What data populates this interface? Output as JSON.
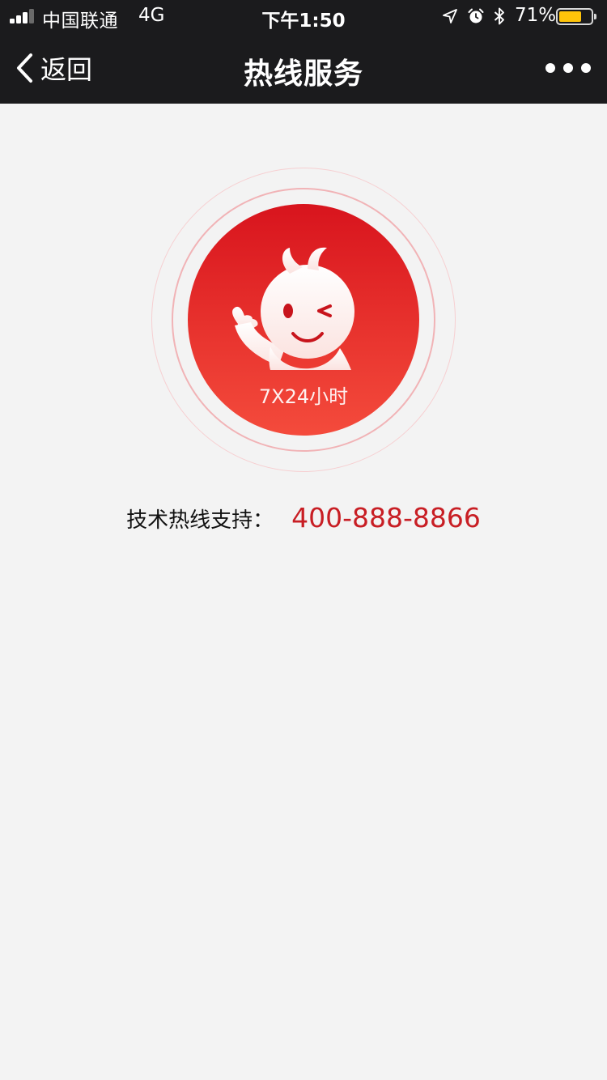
{
  "status_bar": {
    "carrier": "中国联通",
    "network": "4G",
    "time": "下午1:50",
    "battery_percent_label": "71%",
    "battery_level": 0.71,
    "battery_color": "#ffc40a",
    "signal_bars_active": 3,
    "icons": [
      "signal-icon",
      "location-arrow-icon",
      "alarm-icon",
      "bluetooth-icon",
      "battery-icon"
    ]
  },
  "nav": {
    "back_label": "返回",
    "title": "热线服务",
    "icons": [
      "chevron-left-icon",
      "more-dots-icon"
    ]
  },
  "badge": {
    "text": "7X24小时",
    "image": "mascot-winking-thumbs-up",
    "accent_color": "#d8141d"
  },
  "hotline": {
    "label": "技术热线支持：",
    "number": "400-888-8866",
    "number_color": "#c81e24"
  }
}
